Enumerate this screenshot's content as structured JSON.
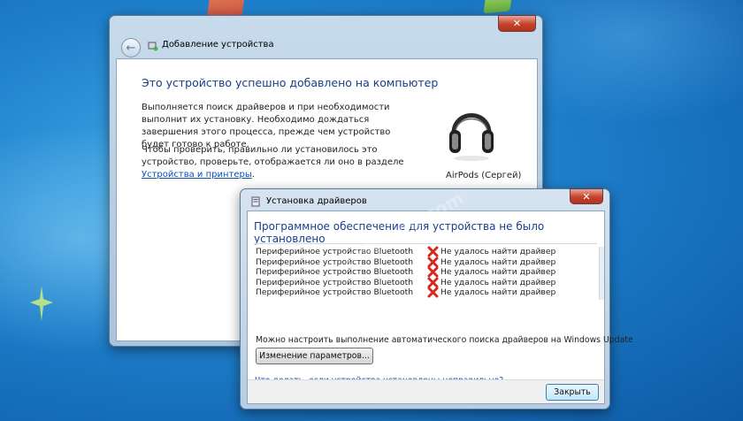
{
  "watermark": "help-wifi.com",
  "add_device_window": {
    "title": "Добавление устройства",
    "close_glyph": "✕",
    "heading": "Это устройство успешно добавлено на компьютер",
    "paragraph1": "Выполняется поиск драйверов и при необходимости выполнит их установку. Необходимо дождаться завершения этого процесса, прежде чем устройство будет готово к работе.",
    "paragraph2_before_link": "Чтобы проверить, правильно ли установилось это устройство, проверьте, отображается ли оно в разделе ",
    "paragraph2_link": "Устройства и принтеры",
    "paragraph2_after_link": ".",
    "device_name": "AirPods (Сергей)",
    "device_icon": "headphones-icon"
  },
  "driver_window": {
    "title": "Установка драйверов",
    "close_glyph": "✕",
    "heading": "Программное обеспечение для устройства не было установлено",
    "rows": [
      {
        "device": "Периферийное устройство Bluetooth",
        "status": "Не удалось найти драйвер"
      },
      {
        "device": "Периферийное устройство Bluetooth",
        "status": "Не удалось найти драйвер"
      },
      {
        "device": "Периферийное устройство Bluetooth",
        "status": "Не удалось найти драйвер"
      },
      {
        "device": "Периферийное устройство Bluetooth",
        "status": "Не удалось найти драйвер"
      },
      {
        "device": "Периферийное устройство Bluetooth",
        "status": "Не удалось найти драйвер"
      }
    ],
    "auto_search_text": "Можно настроить выполнение автоматического поиска драйверов на Windows Update",
    "change_settings_button": "Изменение параметров...",
    "help_link": "Что делать, если устройства установлены неправильно?",
    "close_button": "Закрыть"
  },
  "colors": {
    "heading_blue": "#1a3e8a",
    "link_blue": "#0b50b8",
    "error_red": "#d7281e",
    "desktop_blue": "#1e7fcb"
  }
}
